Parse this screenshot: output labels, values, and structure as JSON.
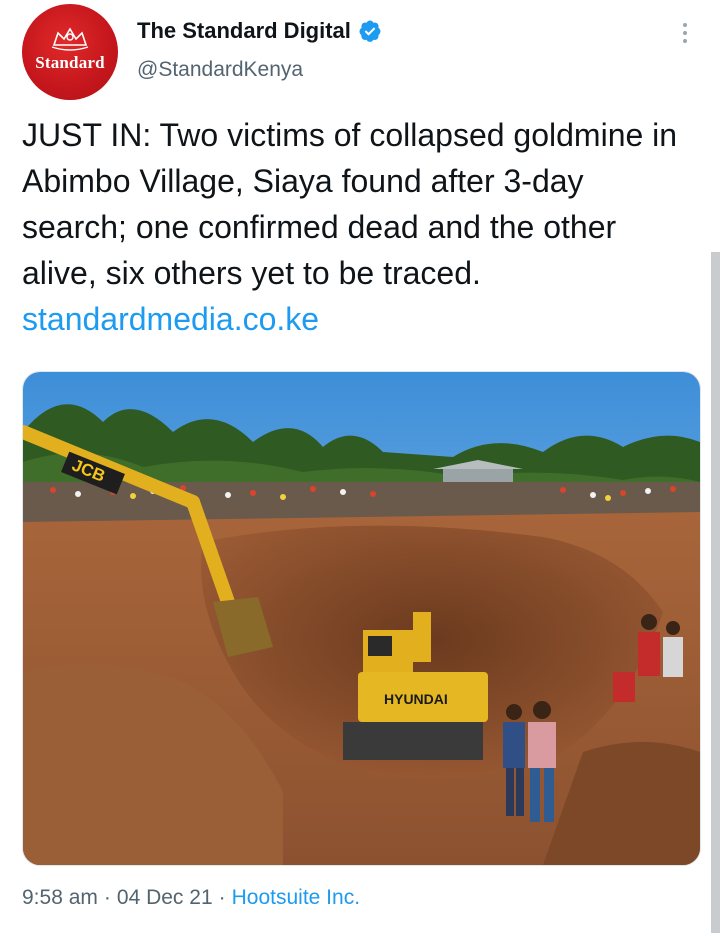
{
  "author": {
    "avatar_text": "Standard",
    "display_name": "The Standard Digital",
    "handle": "@StandardKenya",
    "verified": true
  },
  "tweet": {
    "text": "JUST IN: Two victims of collapsed goldmine in Abimbo Village, Siaya found after 3-day search; one confirmed dead and the other alive, six others yet to be traced.",
    "link": "standardmedia.co.ke"
  },
  "media": {
    "excavator_left_label": "JCB",
    "excavator_center_label": "HYUNDAI"
  },
  "meta": {
    "time": "9:58 am",
    "separator": "·",
    "date": "04 Dec 21",
    "source": "Hootsuite Inc."
  },
  "colors": {
    "accent": "#1d9bf0",
    "text": "#0f1419",
    "muted": "#536471",
    "brand_red": "#c4161c"
  },
  "icons": {
    "verified": "verified-badge-icon",
    "more": "more-options-icon"
  }
}
